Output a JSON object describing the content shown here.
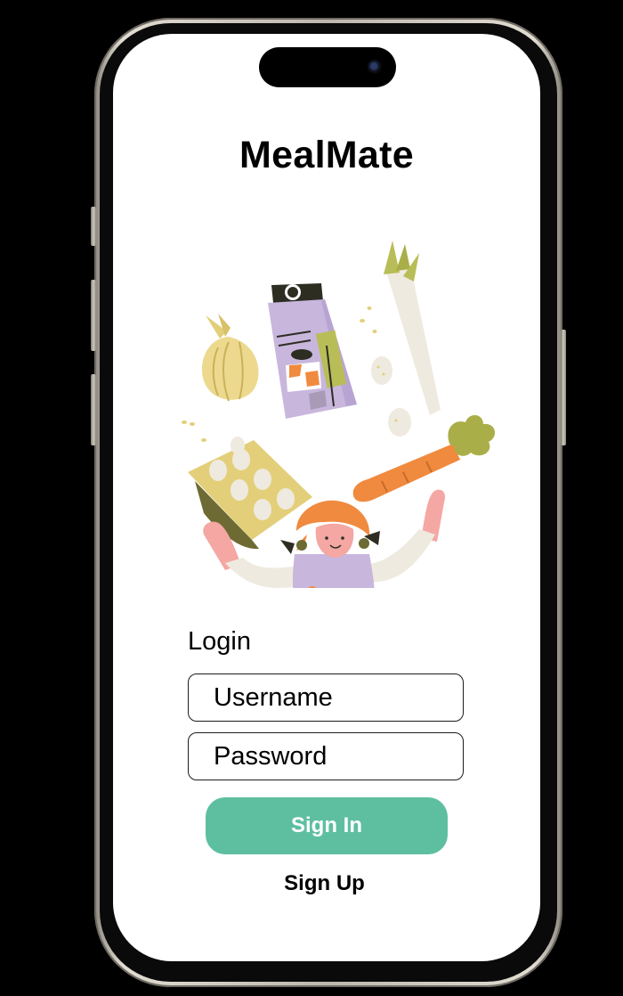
{
  "app": {
    "title": "MealMate"
  },
  "illustration": {
    "description_icon": "groceries-illustration"
  },
  "login": {
    "heading": "Login",
    "username_placeholder": "Username",
    "password_placeholder": "Password",
    "signin_label": "Sign In",
    "signup_label": "Sign Up"
  },
  "colors": {
    "accent": "#5ebfa0",
    "background": "#ffffff",
    "text": "#000000"
  }
}
